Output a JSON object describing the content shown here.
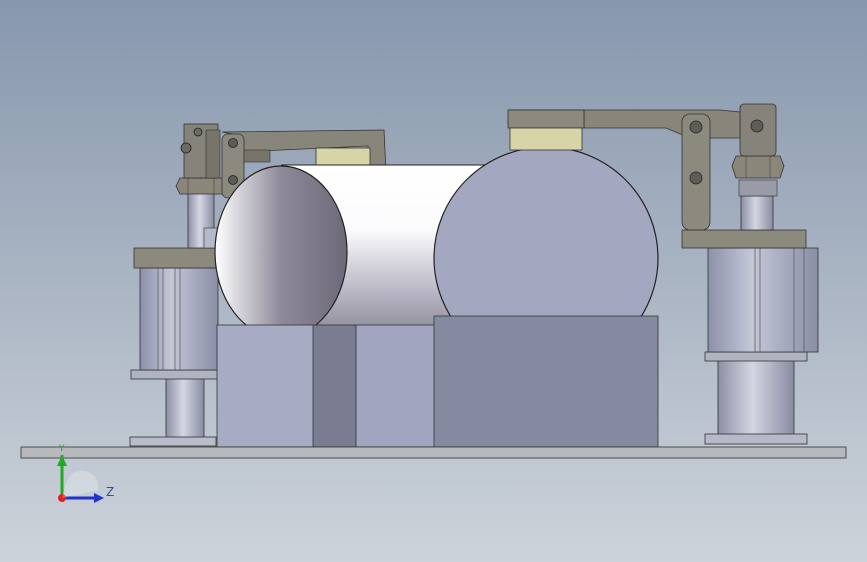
{
  "viewport": {
    "background_top": "#8a9bb0",
    "background_bottom": "#c9d0d8"
  },
  "model": {
    "metal_color": "#7d7a70",
    "cylinder_color": "#a4a8c0",
    "pad_color": "#d8d6a8",
    "base_color": "#b8b9bd"
  },
  "triad": {
    "x_axis_label": "Z",
    "y_axis_label": "Y",
    "z_color": "#2233cc",
    "y_color": "#22aa22",
    "x_color": "#dd2222"
  }
}
